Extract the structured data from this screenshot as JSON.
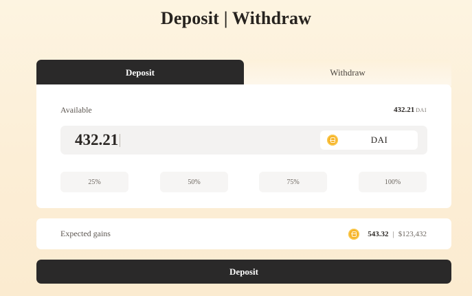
{
  "header": {
    "title": "Deposit | Withdraw"
  },
  "tabs": [
    {
      "label": "Deposit",
      "active": true
    },
    {
      "label": "Withdraw",
      "active": false
    }
  ],
  "available": {
    "label": "Available",
    "amount": "432.21",
    "unit": "DAI"
  },
  "amount_input": {
    "value": "432.21",
    "placeholder": ""
  },
  "token": {
    "symbol": "DAI",
    "icon": "dai-coin-icon",
    "color": "#f6b42b"
  },
  "percent_buttons": [
    "25%",
    "50%",
    "75%",
    "100%"
  ],
  "expected_gains": {
    "label": "Expected gains",
    "amount": "543.32",
    "separator": "|",
    "usd": "$123,432"
  },
  "action": {
    "label": "Deposit"
  },
  "colors": {
    "dark": "#2a2929",
    "accent_coin": "#f6b42b",
    "background": "#fdf4e1"
  }
}
